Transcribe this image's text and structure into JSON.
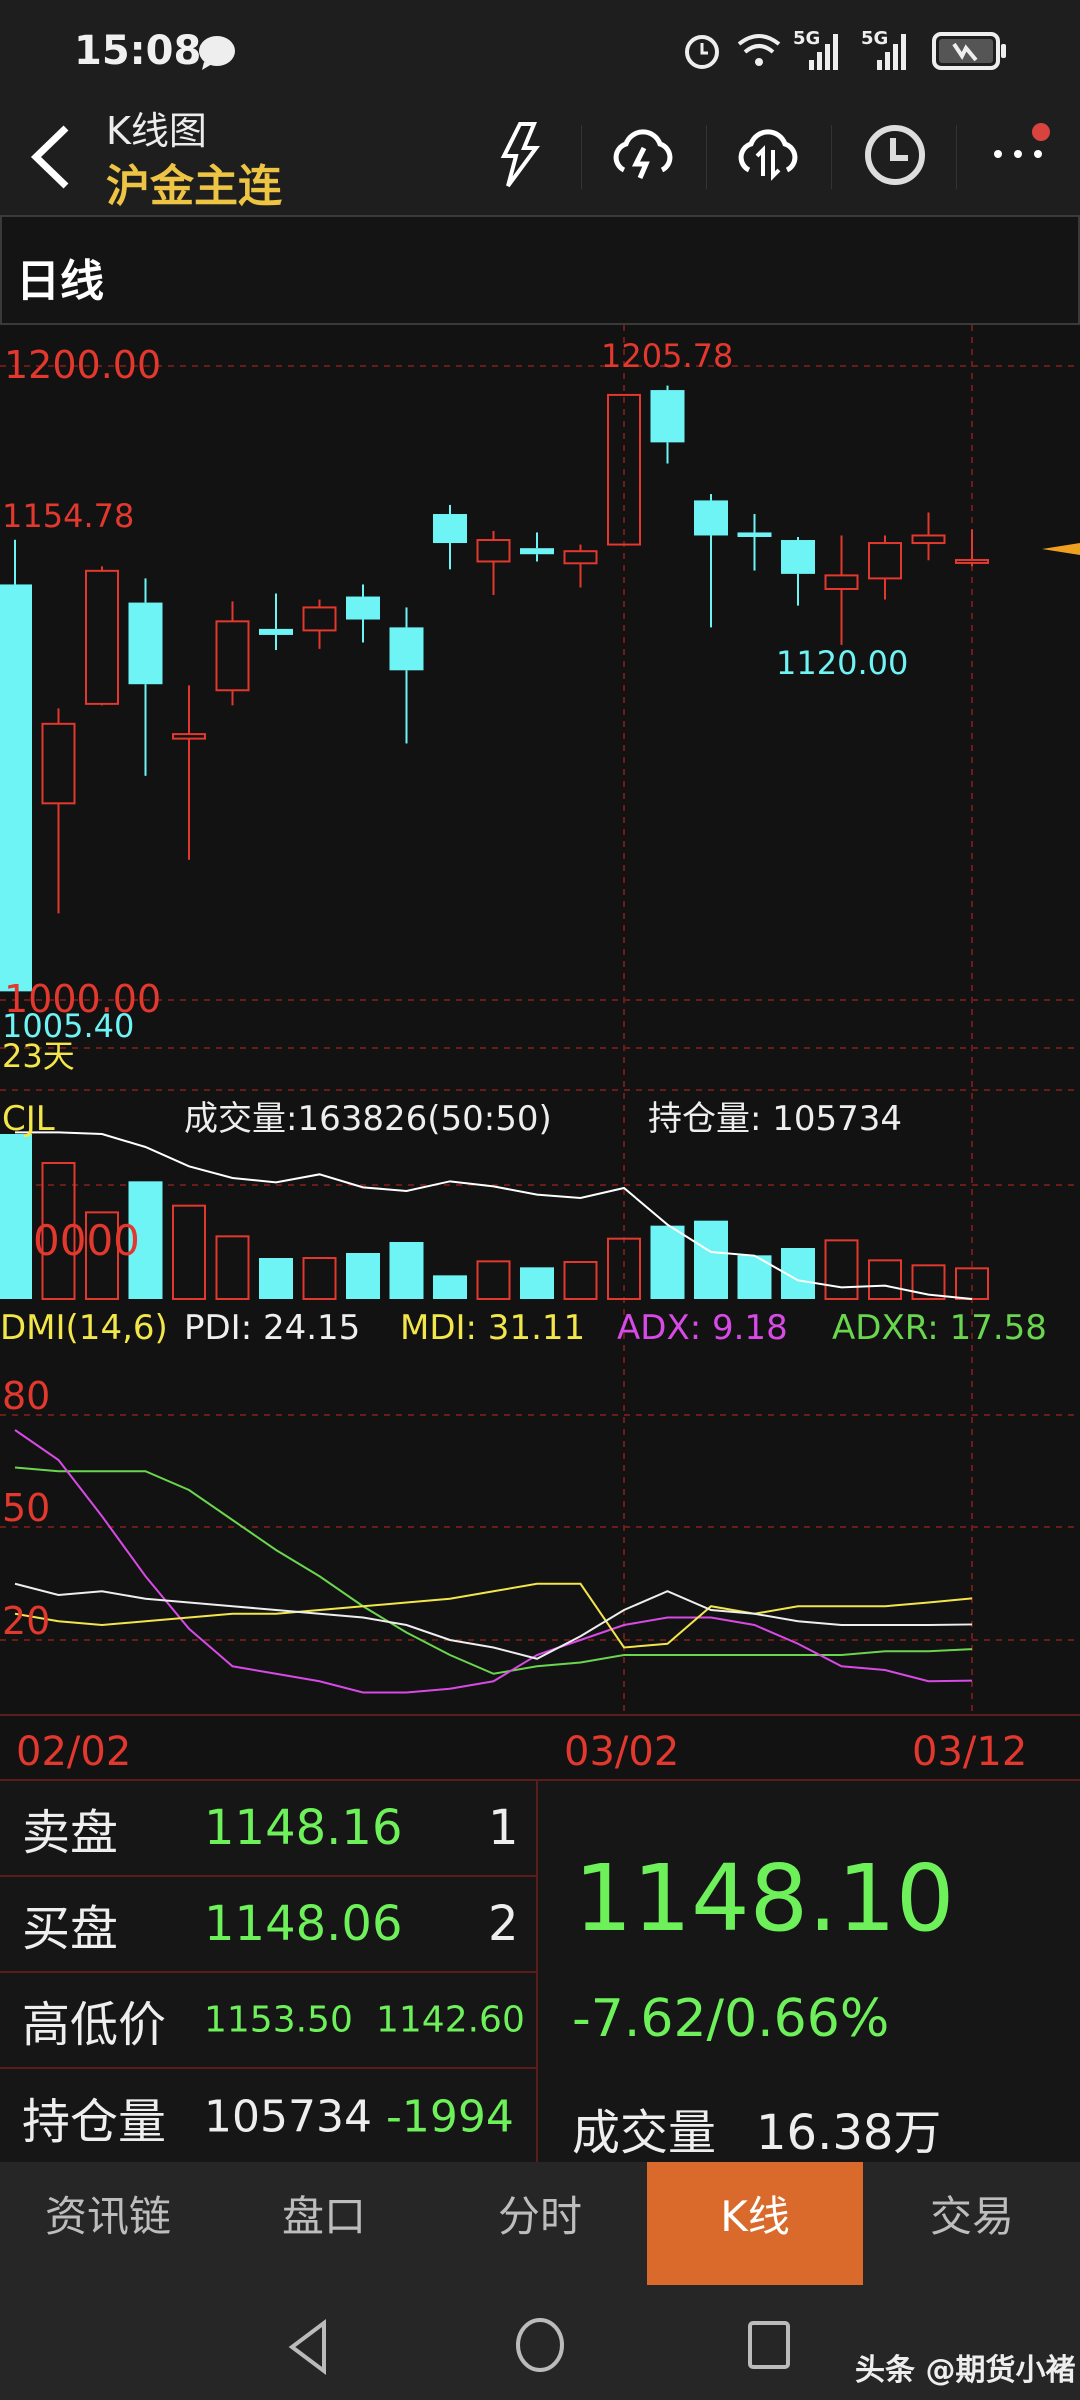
{
  "status_bar": {
    "time": "15:08",
    "network1": "5G",
    "network2": "5G"
  },
  "header": {
    "title": "K线图",
    "contract": "沪金主连"
  },
  "period": {
    "label": "日线"
  },
  "price_chart": {
    "labels": {
      "top": "1200.00",
      "bottom": "1000.00",
      "high_left": "1154.78",
      "high_peak": "1205.78",
      "low_right": "1120.00",
      "low_left": "1005.40",
      "days": "23天"
    }
  },
  "volume_panel": {
    "title": "CJL",
    "volume_text": "成交量:163826(50:50)",
    "oi_text": "持仓量: 105734",
    "axis_label": "0000"
  },
  "dmi_panel": {
    "title": "DMI(14,6)",
    "pdi": "PDI: 24.15",
    "mdi": "MDI: 31.11",
    "adx": "ADX: 9.18",
    "adxr": "ADXR: 17.58",
    "levels": [
      "80",
      "50",
      "20"
    ]
  },
  "dates": [
    "02/02",
    "03/02",
    "03/12"
  ],
  "colors": {
    "up": "#e2382d",
    "down": "#6ff4f6",
    "pdi": "#eeeeee",
    "mdi": "#f2e64a",
    "adx": "#d84ae6",
    "adxr": "#6ad64e",
    "accent": "#d96a2b"
  },
  "chart_data": {
    "type": "candlestick",
    "candles": [
      {
        "o": 1140,
        "h": 1154.78,
        "l": 1005.4,
        "c": 1005.4
      },
      {
        "o": 1067.6,
        "h": 1099,
        "l": 1031.2,
        "c": 1093.9
      },
      {
        "o": 1100.5,
        "h": 1146,
        "l": 1100,
        "c": 1144.5
      },
      {
        "o": 1134,
        "h": 1142,
        "l": 1076.7,
        "c": 1107
      },
      {
        "o": 1089,
        "h": 1106.6,
        "l": 1048.9,
        "c": 1090.5
      },
      {
        "o": 1105,
        "h": 1134.4,
        "l": 1100,
        "c": 1127.8
      },
      {
        "o": 1125.3,
        "h": 1137,
        "l": 1118.3,
        "c": 1123.3
      },
      {
        "o": 1124.8,
        "h": 1135,
        "l": 1118.7,
        "c": 1132.4
      },
      {
        "o": 1136,
        "h": 1140,
        "l": 1120.8,
        "c": 1128.4
      },
      {
        "o": 1125.8,
        "h": 1132.4,
        "l": 1087.4,
        "c": 1111.6
      },
      {
        "o": 1163.3,
        "h": 1166.3,
        "l": 1145,
        "c": 1153.7
      },
      {
        "o": 1147.6,
        "h": 1157.7,
        "l": 1136.5,
        "c": 1154.7
      },
      {
        "o": 1152,
        "h": 1157.2,
        "l": 1147.6,
        "c": 1150
      },
      {
        "o": 1147,
        "h": 1153.2,
        "l": 1139,
        "c": 1151
      },
      {
        "o": 1153.2,
        "h": 1203,
        "l": 1153,
        "c": 1202.7
      },
      {
        "o": 1204.3,
        "h": 1205.78,
        "l": 1180,
        "c": 1187
      },
      {
        "o": 1167.8,
        "h": 1169.9,
        "l": 1125.8,
        "c": 1156.2
      },
      {
        "o": 1157.2,
        "h": 1163.3,
        "l": 1144.6,
        "c": 1155.7
      },
      {
        "o": 1154.7,
        "h": 1155.7,
        "l": 1133,
        "c": 1143.5
      },
      {
        "o": 1138.5,
        "h": 1156.2,
        "l": 1120,
        "c": 1143
      },
      {
        "o": 1142,
        "h": 1156.2,
        "l": 1135,
        "c": 1153.7
      },
      {
        "o": 1153.7,
        "h": 1163.8,
        "l": 1148,
        "c": 1156.2
      },
      {
        "o": 1147.5,
        "h": 1158.2,
        "l": 1146,
        "c": 1148.1
      }
    ],
    "volume": [
      881600,
      726700,
      463000,
      628700,
      498700,
      334800,
      219000,
      219000,
      245800,
      304500,
      126400,
      201200,
      169200,
      197700,
      322300,
      391800,
      418500,
      233300,
      272500,
      313400,
      206600,
      179900,
      163826
    ],
    "open_interest": [
      160734,
      160734,
      160184,
      155894,
      149514,
      145664,
      144234,
      146874,
      142584,
      141374,
      144564,
      142914,
      140164,
      139064,
      142364,
      130264,
      121244,
      120034,
      111894,
      109584,
      110134,
      107164,
      105734
    ],
    "pdi": [
      35,
      32,
      33,
      31,
      30,
      29,
      28,
      27,
      26,
      24,
      20,
      18,
      15,
      21,
      28,
      33,
      28,
      27,
      25,
      24,
      24,
      24,
      24.15
    ],
    "mdi": [
      27,
      25,
      24,
      25,
      26,
      27,
      27,
      28,
      29,
      30,
      31,
      33,
      35,
      35,
      18,
      19,
      29,
      27,
      29,
      29,
      29,
      30,
      31.11
    ],
    "adx": [
      76,
      68,
      53,
      37,
      23,
      13,
      11,
      9,
      6,
      6,
      7,
      9,
      16,
      20,
      24,
      26,
      26,
      24,
      19,
      13,
      12,
      9,
      9.18
    ],
    "adxr": [
      66,
      65,
      65,
      65,
      60,
      52,
      44,
      37,
      29,
      22,
      16,
      11,
      13,
      14,
      16,
      16,
      16,
      16,
      16,
      16,
      17,
      17,
      17.58
    ],
    "price_range": [
      1000,
      1205.78
    ],
    "x_labels": [
      "02/02",
      "03/02",
      "03/12"
    ]
  },
  "quote": {
    "ask_label": "卖盘",
    "ask_price": "1148.16",
    "ask_qty": "1",
    "bid_label": "买盘",
    "bid_price": "1148.06",
    "bid_qty": "2",
    "hl_label": "高低价",
    "high": "1153.50",
    "low": "1142.60",
    "oi_label": "持仓量",
    "oi_value": "105734",
    "oi_change": "-1994",
    "last_price": "1148.10",
    "change": "-7.62/0.66%",
    "vol_label": "成交量",
    "vol_value": "16.38万"
  },
  "tabs": [
    {
      "label": "资讯链"
    },
    {
      "label": "盘口"
    },
    {
      "label": "分时"
    },
    {
      "label": "K线"
    },
    {
      "label": "交易"
    }
  ],
  "watermark": "头条 @期货小褚"
}
